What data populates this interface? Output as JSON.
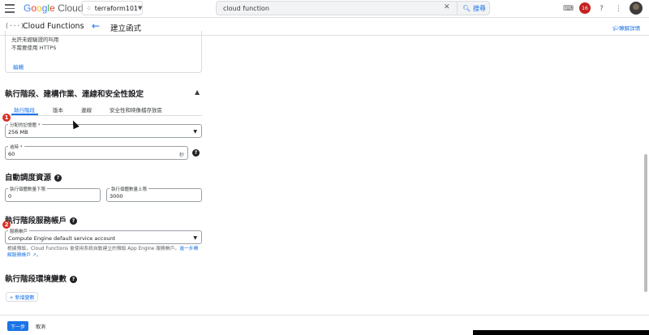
{
  "header": {
    "logo_google": [
      "G",
      "o",
      "o",
      "g",
      "l",
      "e"
    ],
    "logo_cloud": "Cloud",
    "project": "terraform101",
    "search_value": "cloud function",
    "search_button": "搜尋",
    "notification_count": "16"
  },
  "subheader": {
    "product": "Cloud Functions",
    "page_title": "建立函式",
    "learn": "瞭解詳情"
  },
  "card": {
    "line1": "允許未經驗證的叫用",
    "line2": "不需要使用 HTTPS",
    "edit": "編輯"
  },
  "sections": {
    "runtime_title": "執行階段、建構作業、連線和安全性設定",
    "autoscale_title": "自動調度資源",
    "service_account_title": "執行階段服務帳戶",
    "env_title": "執行階段環境變數"
  },
  "tabs": [
    "執行階段",
    "版本",
    "連線",
    "安全性和映像檔存放區"
  ],
  "fields": {
    "memory": {
      "label": "分配的記憶體 *",
      "value": "256 MB"
    },
    "timeout": {
      "label": "逾時 *",
      "value": "60",
      "suffix": "秒"
    },
    "min_instances": {
      "label": "執行個體數量下限",
      "value": "0"
    },
    "max_instances": {
      "label": "執行個體數量上限",
      "value": "3000"
    },
    "service_account": {
      "label": "服務帳戶",
      "value": "Compute Engine default service account"
    }
  },
  "markers": [
    "1",
    "2"
  ],
  "hint": {
    "text": "根據預設，Cloud Functions 會使用系統自動建立的預設 App Engine 服務帳戶。",
    "link": "進一步瞭解服務帳戶",
    "end": "。"
  },
  "add_variable": "+ 新增變數",
  "footer": {
    "next": "下一步",
    "cancel": "取消"
  }
}
